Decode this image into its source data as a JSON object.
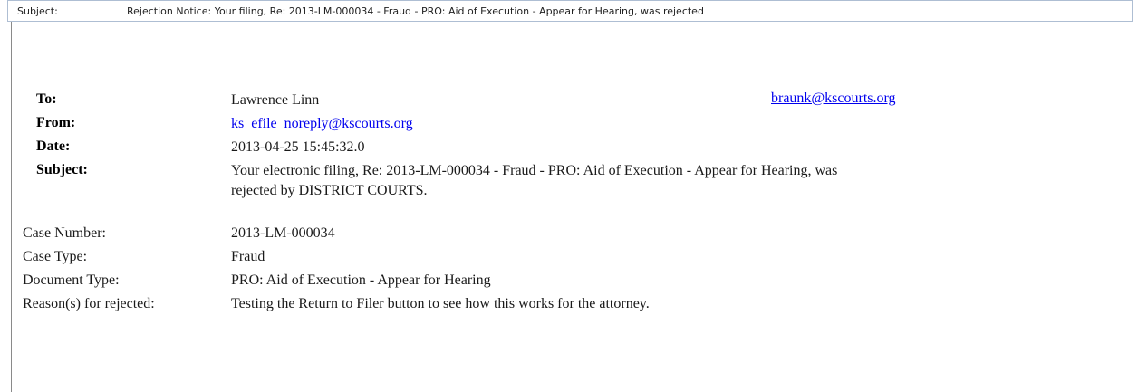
{
  "subject_bar": {
    "label": "Subject:",
    "value": "Rejection Notice: Your filing, Re: 2013-LM-000034 - Fraud - PRO: Aid of Execution - Appear for Hearing, was rejected"
  },
  "header": {
    "to_label": "To:",
    "to_name": "Lawrence Linn",
    "to_email": "braunk@kscourts.org",
    "from_label": "From:",
    "from_email": "ks_efile_noreply@kscourts.org",
    "date_label": "Date:",
    "date_value": "2013-04-25 15:45:32.0",
    "subject_label": "Subject:",
    "subject_line1": "Your electronic filing, Re: 2013-LM-000034 - Fraud - PRO: Aid of Execution - Appear for Hearing, was",
    "subject_line2": "rejected by DISTRICT COURTS."
  },
  "details": {
    "case_number_label": "Case Number:",
    "case_number_value": "2013-LM-000034",
    "case_type_label": "Case Type:",
    "case_type_value": "Fraud",
    "document_type_label": "Document Type:",
    "document_type_value": "PRO: Aid of Execution - Appear for Hearing",
    "reason_label": "Reason(s) for rejected:",
    "reason_value": "Testing the Return to Filer button to see how this works for the attorney."
  },
  "colors": {
    "link": "#0000ee",
    "subject_bar_border": "#aebed3"
  }
}
